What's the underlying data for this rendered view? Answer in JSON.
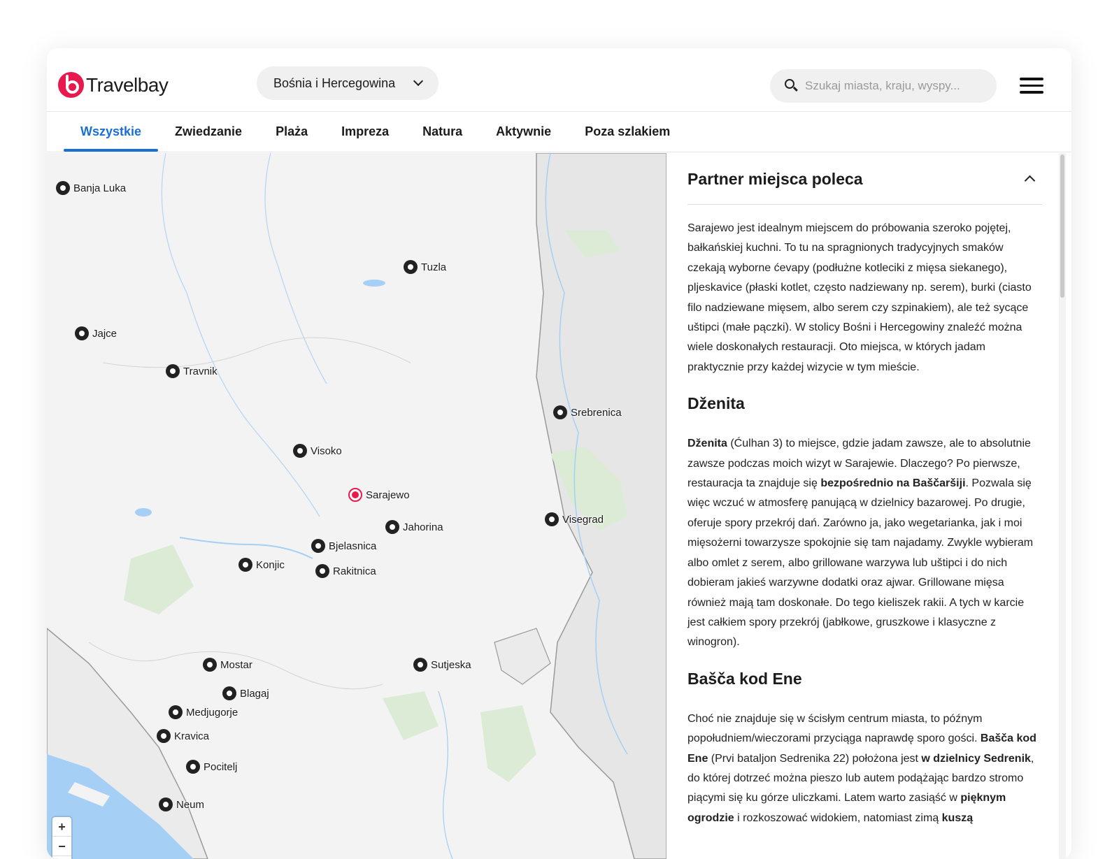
{
  "logo": {
    "text": "Travelbay"
  },
  "country_select": {
    "value": "Bośnia i Hercegowina"
  },
  "search": {
    "placeholder": "Szukaj miasta, kraju, wyspy..."
  },
  "tabs": [
    {
      "label": "Wszystkie",
      "active": true
    },
    {
      "label": "Zwiedzanie"
    },
    {
      "label": "Plaża"
    },
    {
      "label": "Impreza"
    },
    {
      "label": "Natura"
    },
    {
      "label": "Aktywnie"
    },
    {
      "label": "Poza szlakiem"
    }
  ],
  "map": {
    "places": [
      "Banja Luka",
      "Tuzla",
      "Jajce",
      "Travnik",
      "Srebrenica",
      "Visoko",
      "Sarajewo",
      "Jahorina",
      "Visegrad",
      "Bjelasnica",
      "Konjic",
      "Rakitnica",
      "Mostar",
      "Sutjeska",
      "Blagaj",
      "Medjugorje",
      "Kravica",
      "Pocitelj",
      "Neum"
    ],
    "selected": "Sarajewo",
    "zoom_in": "+",
    "zoom_out": "−",
    "compass": "▲",
    "colors": {
      "water": "#a6cff5",
      "park": "#dcebd6",
      "land": "#f3f3f3",
      "selected_pin": "#e8194d"
    }
  },
  "panel": {
    "title": "Partner miejsca poleca",
    "intro": "Sarajewo jest idealnym miejscem do próbowania szeroko pojętej, bałkańskiej kuchni. To tu na spragnionych tradycyjnych smaków czekają wyborne ćevapy (podłużne kotleciki z mięsa siekanego), pljeskavice (płaski kotlet, często nadziewany np. serem), burki (ciasto filo nadziewane mięsem, albo serem czy szpinakiem), ale też sycące uštipci (małe pączki). W stolicy Bośni i Hercegowiny znaleźć można wiele doskonałych restauracji. Oto miejsca, w których jadam praktycznie przy każdej wizycie w tym mieście.",
    "sections": [
      {
        "title": "Dženita",
        "b1": "Dženita",
        "t1": " (Ćulhan 3) to miejsce, gdzie jadam zawsze, ale to absolutnie zawsze podczas moich wizyt w Sarajewie. Dlaczego? Po pierwsze, restauracja ta znajduje się ",
        "b2": "bezpośrednio na Baščaršiji",
        "t2": ". Pozwala się więc wczuć w atmosferę panującą w dzielnicy bazarowej. Po drugie, oferuje spory przekrój dań. Zarówno ja, jako wegetarianka, jak i moi mięsożerni towarzysze spokojnie się tam najadamy. Zwykle wybieram albo omlet z serem, albo grillowane warzywa lub uštipci i do nich dobieram jakieś warzywne dodatki oraz ajwar. Grillowane mięsa również mają tam doskonałe. Do tego kieliszek rakii. A tych w karcie jest całkiem spory przekrój (jabłkowe, gruszkowe i klasyczne z winogron)."
      },
      {
        "title": "Bašča kod Ene",
        "t1": "Choć nie znajduje się w ścisłym centrum miasta, to późnym popołudniem/wieczorami przyciąga naprawdę sporo gości. ",
        "b1": "Bašča kod Ene",
        "t2": " (Prvi bataljon Sedrenika 22) położona jest ",
        "b2": "w dzielnicy Sedrenik",
        "t3": ", do której dotrzeć można pieszo lub autem podążając bardzo stromo piącymi się ku górze uliczkami. Latem warto zasiąść w ",
        "b3": "pięknym ogrodzie",
        "t4": " i rozkoszować widokiem, natomiast zimą ",
        "b4": "kuszą"
      }
    ]
  }
}
